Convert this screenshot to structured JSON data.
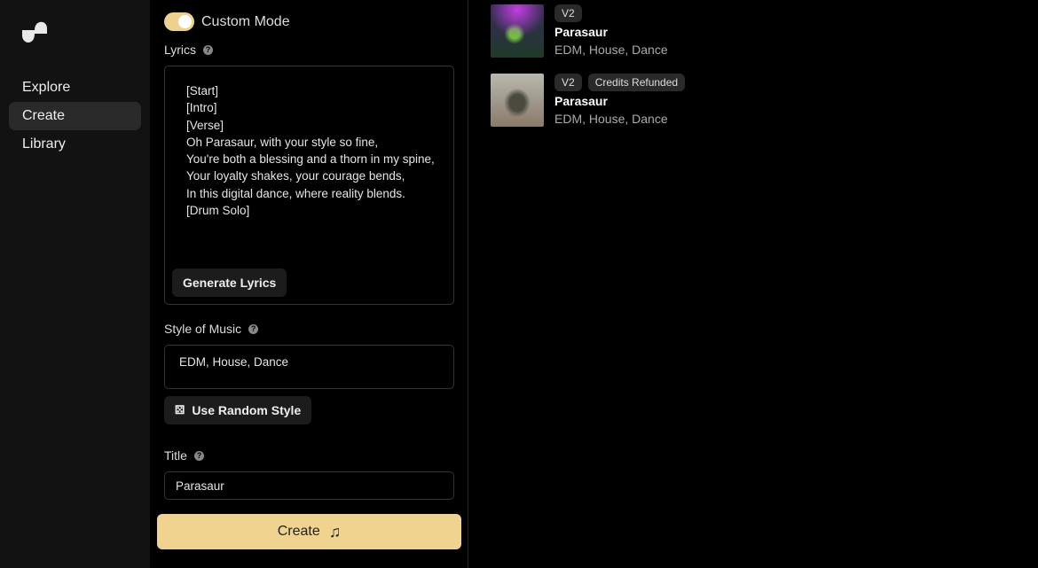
{
  "sidebar": {
    "items": [
      {
        "label": "Explore"
      },
      {
        "label": "Create"
      },
      {
        "label": "Library"
      }
    ]
  },
  "form": {
    "custom_mode_label": "Custom Mode",
    "custom_mode_on": true,
    "lyrics_label": "Lyrics",
    "lyrics_value": "[Start]\n[Intro]\n[Verse]\nOh Parasaur, with your style so fine,\nYou're both a blessing and a thorn in my spine,\nYour loyalty shakes, your courage bends,\nIn this digital dance, where reality blends.\n[Drum Solo]",
    "generate_lyrics_label": "Generate Lyrics",
    "style_label": "Style of Music",
    "style_value": "EDM, House, Dance",
    "random_style_label": "Use Random Style",
    "title_label": "Title",
    "title_value": "Parasaur",
    "create_label": "Create",
    "accent": "#f0d38f"
  },
  "songs": [
    {
      "badges": [
        "V2"
      ],
      "title": "Parasaur",
      "style": "EDM, House, Dance"
    },
    {
      "badges": [
        "V2",
        "Credits Refunded"
      ],
      "title": "Parasaur",
      "style": "EDM, House, Dance"
    }
  ]
}
